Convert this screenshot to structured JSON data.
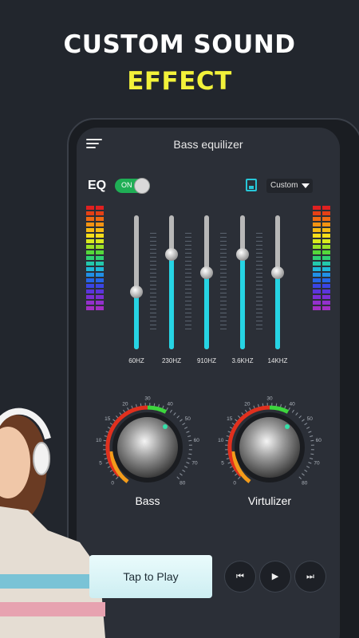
{
  "promo": {
    "line1": "CUSTOM SOUND",
    "line2": "EFFECT"
  },
  "header": {
    "title": "Bass equilizer",
    "menu_icon": "menu-icon"
  },
  "eq": {
    "label": "EQ",
    "toggle_text": "ON",
    "toggle_on": true,
    "save_icon": "save-icon",
    "preset": "Custom"
  },
  "bands": [
    {
      "label": "60HZ",
      "level": 0.43
    },
    {
      "label": "230HZ",
      "level": 0.71
    },
    {
      "label": "910HZ",
      "level": 0.57
    },
    {
      "label": "3.6KHZ",
      "level": 0.71
    },
    {
      "label": "14KHZ",
      "level": 0.57
    }
  ],
  "knobs": [
    {
      "label": "Bass",
      "ticks": [
        "0",
        "5",
        "10",
        "15",
        "20",
        "30",
        "40",
        "50",
        "60",
        "70",
        "80"
      ]
    },
    {
      "label": "Virtulizer",
      "ticks": [
        "0",
        "5",
        "10",
        "15",
        "20",
        "30",
        "40",
        "50",
        "60",
        "70",
        "80"
      ]
    }
  ],
  "player": {
    "tap_label": "Tap to Play",
    "controls": [
      {
        "name": "previous-icon",
        "glyph": "⏮"
      },
      {
        "name": "play-icon",
        "glyph": "▶"
      },
      {
        "name": "next-icon",
        "glyph": "⏭"
      }
    ]
  },
  "colors": {
    "accent": "#26d4e4",
    "toggle": "#1fae55",
    "promo_highlight": "#f2f23a"
  }
}
